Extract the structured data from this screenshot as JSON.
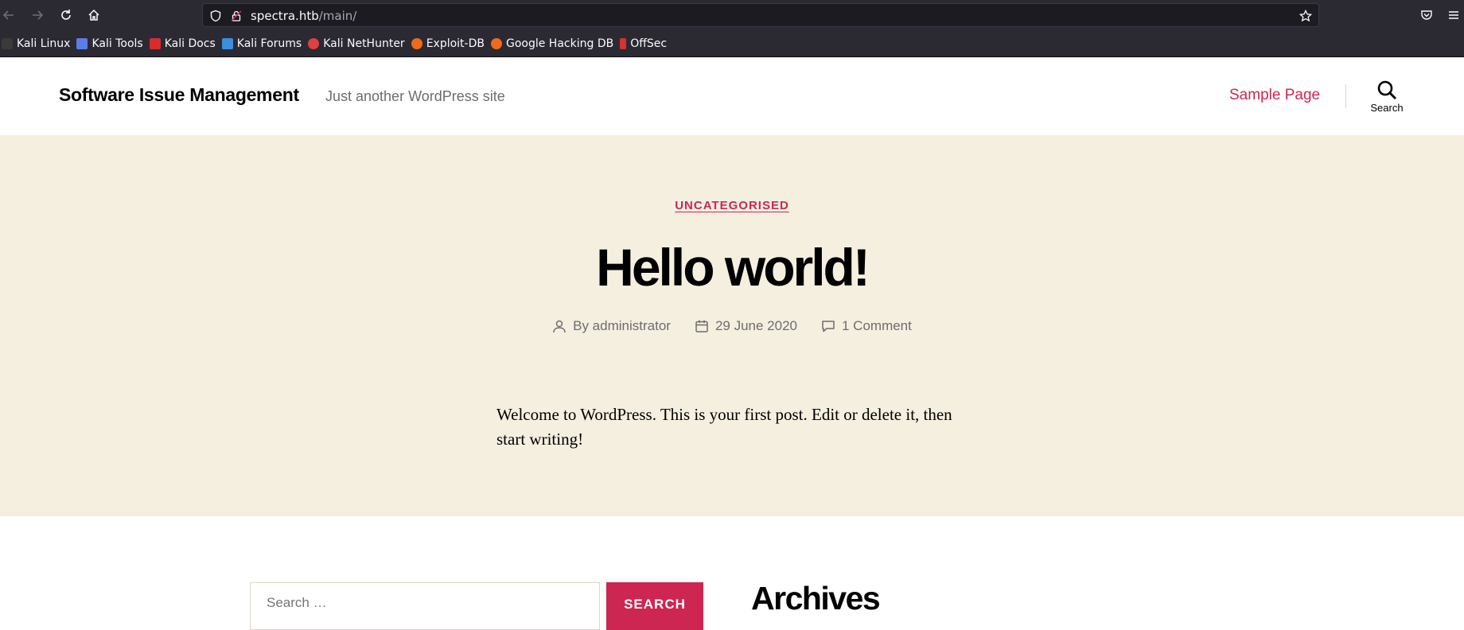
{
  "browser": {
    "url_host": "spectra.htb",
    "url_path": "/main/",
    "bookmarks": [
      {
        "label": "Kali Linux",
        "color": "#e6e6e6"
      },
      {
        "label": "Kali Tools",
        "color": "#5a7ee8"
      },
      {
        "label": "Kali Docs",
        "color": "#d92b2b"
      },
      {
        "label": "Kali Forums",
        "color": "#3a8fe0"
      },
      {
        "label": "Kali NetHunter",
        "color": "#e04040"
      },
      {
        "label": "Exploit-DB",
        "color": "#f06a1a"
      },
      {
        "label": "Google Hacking DB",
        "color": "#f06a1a"
      },
      {
        "label": "OffSec",
        "color": "#d83030"
      }
    ]
  },
  "header": {
    "site_title": "Software Issue Management",
    "site_description": "Just another WordPress site",
    "menu_item": "Sample Page",
    "search_label": "Search"
  },
  "post": {
    "category": "UNCATEGORISED",
    "title": "Hello world!",
    "author": "By administrator",
    "date": "29 June 2020",
    "comments": "1 Comment",
    "content": "Welcome to WordPress. This is your first post. Edit or delete it, then start writing!"
  },
  "widgets": {
    "search_placeholder": "Search …",
    "search_button": "SEARCH",
    "archives_title": "Archives"
  },
  "colors": {
    "accent": "#cd2653",
    "hero_bg": "#f5efe0",
    "chrome_bg": "#2b2a33"
  }
}
